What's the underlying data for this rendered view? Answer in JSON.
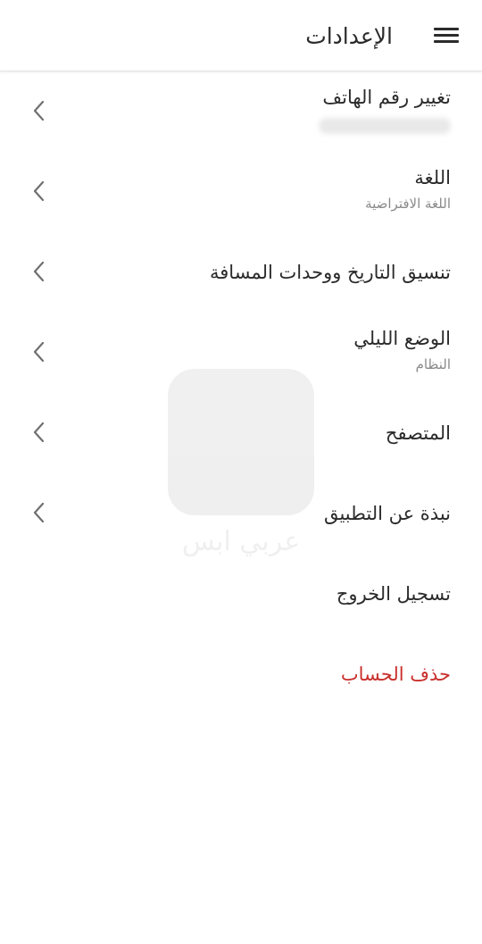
{
  "header": {
    "title": "الإعدادات",
    "menu_icon": "hamburger-menu-icon"
  },
  "settings": {
    "change_phone": {
      "title": "تغيير رقم الهاتف",
      "subtitle_blurred": true
    },
    "language": {
      "title": "اللغة",
      "subtitle": "اللغة الافتراضية"
    },
    "formats": {
      "title": "تنسيق التاريخ ووحدات المسافة"
    },
    "night_mode": {
      "title": "الوضع الليلي",
      "subtitle": "النظام"
    },
    "browser": {
      "title": "المتصفح"
    },
    "about": {
      "title": "نبذة عن التطبيق"
    },
    "logout": {
      "title": "تسجيل الخروج"
    },
    "delete_account": {
      "title": "حذف الحساب"
    }
  },
  "watermark": {
    "text": "عربي ابس"
  },
  "colors": {
    "text": "#2b2b2b",
    "subtitle": "#8a8a8a",
    "danger": "#c9302c",
    "chevron": "#6f6f6f"
  },
  "icons": {
    "chevron": "chevron-left-icon"
  }
}
